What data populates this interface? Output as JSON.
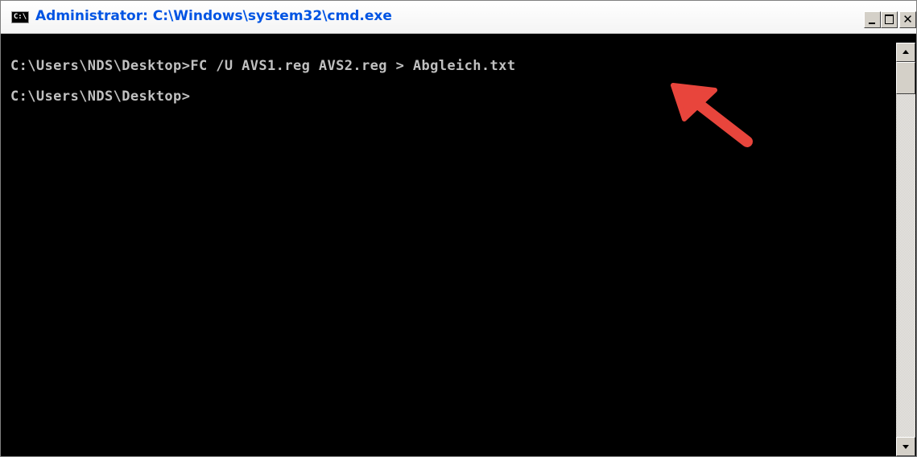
{
  "window": {
    "title": "Administrator: C:\\Windows\\system32\\cmd.exe",
    "app_icon_text": "C:\\",
    "close_glyph": "✕"
  },
  "console": {
    "lines": [
      "C:\\Users\\NDS\\Desktop>FC /U AVS1.reg AVS2.reg > Abgleich.txt",
      "C:\\Users\\NDS\\Desktop>"
    ]
  },
  "annotation": {
    "type": "arrow-icon",
    "color": "#e8453c"
  },
  "colors": {
    "console_bg": "#000000",
    "console_text": "#c0c0c0",
    "title_text": "#0054e3"
  }
}
